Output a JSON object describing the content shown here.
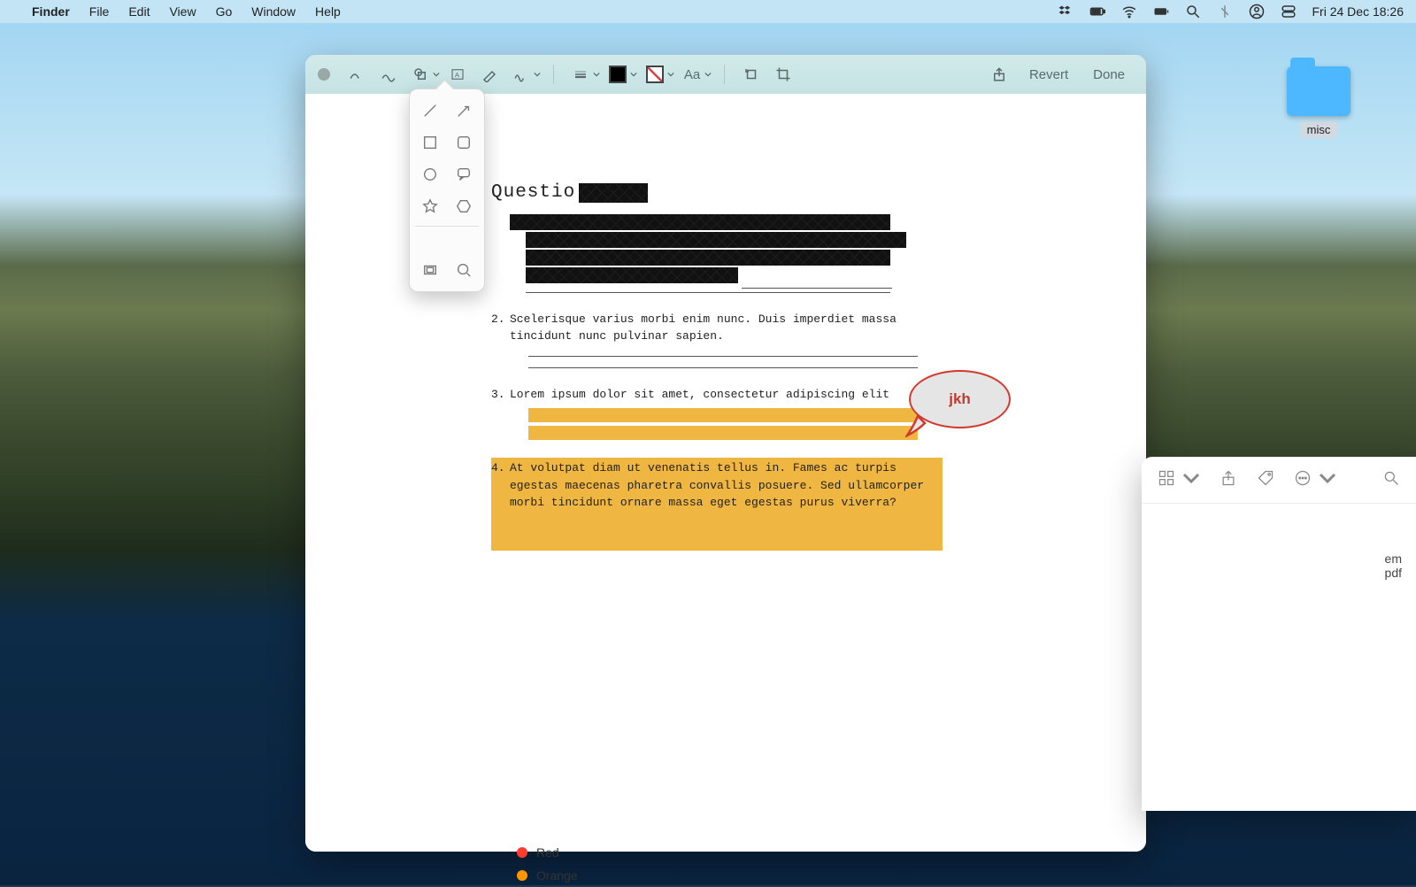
{
  "menubar": {
    "app": "Finder",
    "items": [
      "File",
      "Edit",
      "View",
      "Go",
      "Window",
      "Help"
    ],
    "clock": "Fri 24 Dec  18:26"
  },
  "desktop": {
    "folder_label": "misc"
  },
  "preview": {
    "revert_label": "Revert",
    "done_label": "Done",
    "text_style_label": "Aa"
  },
  "document": {
    "heading_prefix": "Questio",
    "q2_num": "2.",
    "q2_text": "Scelerisque varius morbi enim nunc. Duis imperdiet massa tincidunt nunc pulvinar sapien.",
    "q3_num": "3.",
    "q3_text": "Lorem ipsum dolor sit amet, consectetur adipiscing elit",
    "q4_num": "4.",
    "q4_text": "At volutpat diam ut venenatis tellus in. Fames ac turpis egestas maecenas pharetra convallis posuere. Sed ullamcorper morbi tincidunt ornare massa eget egestas purus viverra?",
    "speech_text": "jkh"
  },
  "finder_peek": {
    "file_line1": "em",
    "file_line2": "pdf"
  },
  "tags": {
    "red": "Red",
    "orange": "Orange"
  }
}
